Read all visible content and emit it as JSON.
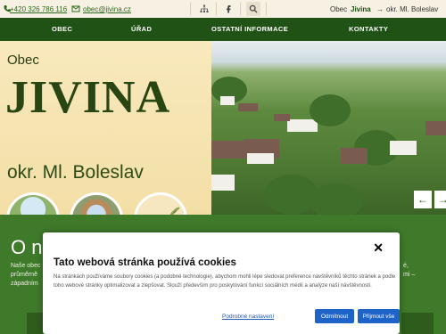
{
  "topbar": {
    "phone": "+420 326 786 116",
    "email": "obec@jivina.cz",
    "crumb_prefix": "Obec",
    "crumb_name": "Jivina",
    "crumb_arrow": "→",
    "crumb_suffix": "okr. Ml. Boleslav"
  },
  "nav": {
    "items": [
      "OBEC",
      "ÚŘAD",
      "OSTATNÍ INFORMACE",
      "KONTAKTY"
    ]
  },
  "hero": {
    "prefix": "Obec",
    "name": "JIVINA",
    "district": "okr. Ml. Boleslav",
    "prev": "←",
    "next": "→"
  },
  "about": {
    "title": "O n",
    "line1_left": "Naše obec",
    "line1_right": "é,",
    "line2_left": "průměrně",
    "line2_right": "mi –",
    "line3_left": "západním"
  },
  "cookie": {
    "close": "✕",
    "title": "Tato webová stránka používá cookies",
    "body": "Na stránkách používáme soubory cookies (a podobné technologie), abychom mohli lépe sledovat preference návštěvníků těchto stránek a podle toho webové stránky optimalizovat a zlepšovat. Slouží především pro poskytování funkcí sociálních médií a analýze naší návštěvnosti.",
    "settings": "Podrobné nastavení",
    "reject": "Odmítnout",
    "accept": "Přijmout vše"
  },
  "colors": {
    "nav_green": "#1f5214",
    "section_green": "#3f7a2a",
    "button_blue": "#1e63c8"
  }
}
